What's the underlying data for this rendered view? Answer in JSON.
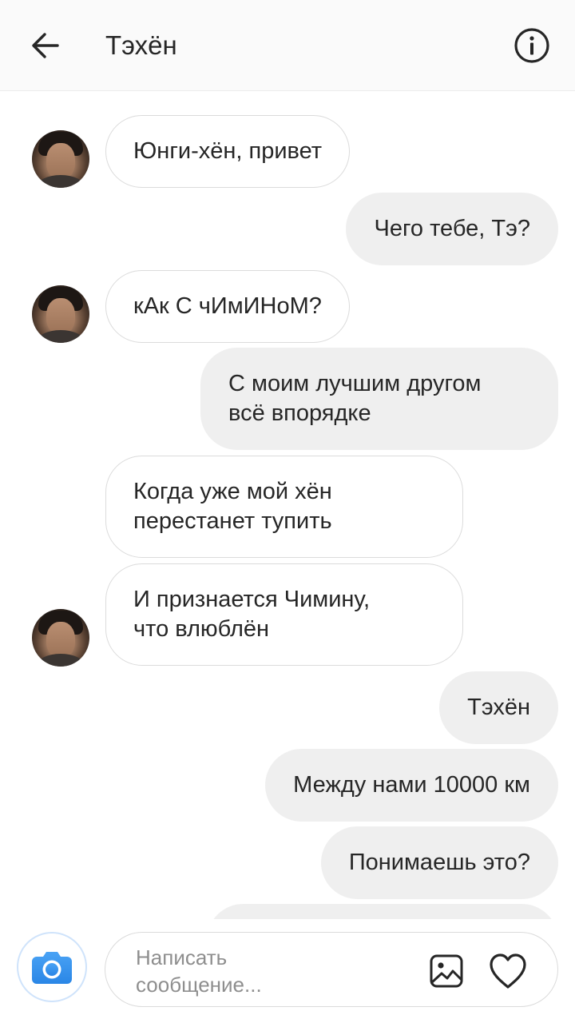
{
  "header": {
    "title": "Тэхён",
    "back_icon": "arrow-left-icon",
    "info_icon": "info-circle-icon"
  },
  "messages": [
    {
      "side": "in",
      "text": "Юнги-хён, привет",
      "avatar": true
    },
    {
      "side": "out",
      "text": "Чего тебе, Тэ?"
    },
    {
      "side": "in",
      "text": "кАк С чИмИНоМ?",
      "avatar": true
    },
    {
      "side": "out",
      "line1": "С моим лучшим другом",
      "line2": "всё впорядке"
    },
    {
      "side": "in",
      "line1": "Когда уже мой хён",
      "line2": "перестанет тупить"
    },
    {
      "side": "in",
      "line1": "И признается Чимину,",
      "line2": "что влюблён",
      "avatar": true
    },
    {
      "side": "out",
      "text": "Тэхён"
    },
    {
      "side": "out",
      "text": "Между нами 10000 км"
    },
    {
      "side": "out",
      "text": "Понимаешь это?"
    }
  ],
  "composer": {
    "camera_icon": "camera-icon",
    "placeholder": "Написать сообщение...",
    "gallery_icon": "image-icon",
    "heart_icon": "heart-icon",
    "accent_color": "#3897f0"
  }
}
